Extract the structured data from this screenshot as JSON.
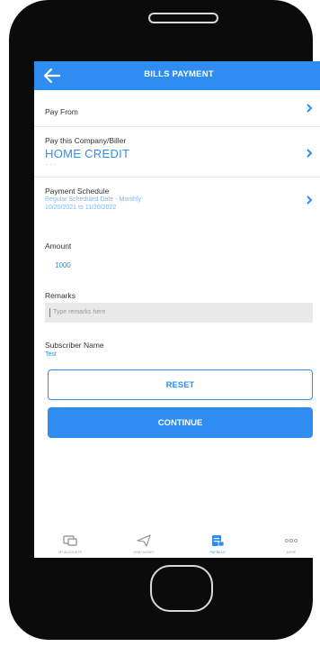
{
  "header": {
    "title": "BILLS PAYMENT"
  },
  "pay_from": {
    "label": "Pay From"
  },
  "biller": {
    "label": "Pay this Company/Biller",
    "value": "HOME CREDIT",
    "sub": "- - -"
  },
  "schedule": {
    "label": "Payment Schedule",
    "line1": "Regular Scheduled Date - Monthly",
    "line2": "10/20/2021 to 11/20/2022"
  },
  "amount": {
    "label": "Amount",
    "value": "1000"
  },
  "remarks": {
    "label": "Remarks",
    "placeholder": "Type remarks here"
  },
  "subscriber": {
    "label": "Subscriber Name",
    "value": "Test"
  },
  "buttons": {
    "reset": "RESET",
    "continue": "CONTINUE"
  },
  "tabs": [
    {
      "label": "MY ACCOUNTS",
      "icon": "accounts-icon"
    },
    {
      "label": "SEND MONEY",
      "icon": "send-icon"
    },
    {
      "label": "PAY BILLS",
      "icon": "bills-icon"
    },
    {
      "label": "MORE",
      "icon": "more-icon"
    }
  ],
  "colors": {
    "accent": "#2f8df2",
    "phone_body": "#0b0b0b"
  }
}
